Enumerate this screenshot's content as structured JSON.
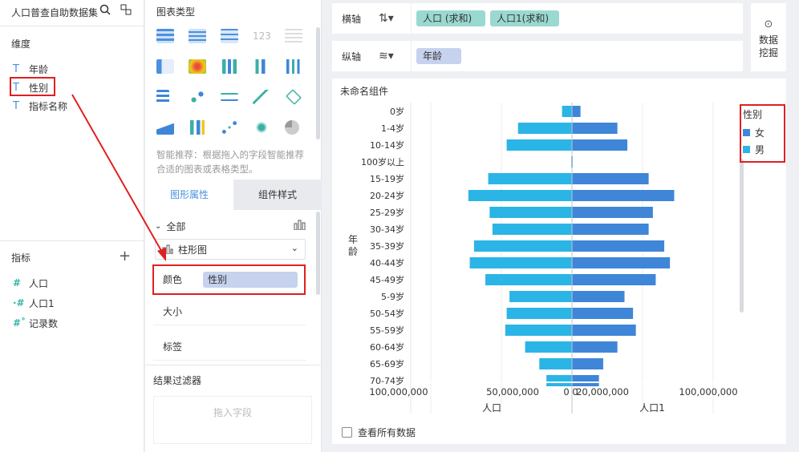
{
  "left_panel": {
    "dataset_title": "人口普查自助数据集",
    "dimensions_header": "维度",
    "dimensions": [
      {
        "label": "年龄",
        "type_glyph": "T"
      },
      {
        "label": "性别",
        "type_glyph": "T"
      },
      {
        "label": "指标名称",
        "type_glyph": "T"
      }
    ],
    "metrics_header": "指标",
    "metrics": [
      {
        "label": "人口",
        "type_glyph": "#"
      },
      {
        "label": "人口1",
        "type_glyph": "·#"
      },
      {
        "label": "记录数",
        "type_glyph": "#˚"
      }
    ]
  },
  "mid_panel": {
    "chart_types_header": "图表类型",
    "smart_tip": "智能推荐：根据拖入的字段智能推荐合适的图表或表格类型。",
    "tabs": [
      "图形属性",
      "组件样式"
    ],
    "all_label": "全部",
    "chart_type_select": "柱形图",
    "color_label": "颜色",
    "color_field": "性别",
    "size_label": "大小",
    "label_label": "标签",
    "filter_header": "结果过滤器",
    "filter_placeholder": "拖入字段"
  },
  "shelves": {
    "x_label": "横轴",
    "x_pills": [
      "人口 (求和)",
      "人口1(求和)"
    ],
    "y_label": "纵轴",
    "y_pills": [
      "年龄"
    ],
    "mining_label": "数据挖掘"
  },
  "chart_header": "未命名组件",
  "legend": {
    "title": "性别",
    "items": [
      {
        "label": "女",
        "color": "#3f86d8"
      },
      {
        "label": "男",
        "color": "#2bb4e6"
      }
    ]
  },
  "view_all_label": "查看所有数据",
  "colors": {
    "female": "#3f86d8",
    "male": "#2bb4e6",
    "accent": "#4a90e2",
    "highlight": "#e02020"
  },
  "chart_data": {
    "type": "bar",
    "orientation": "horizontal-diverging",
    "ylabel": "年龄",
    "categories": [
      "0岁",
      "1-4岁",
      "10-14岁",
      "100岁以上",
      "15-19岁",
      "20-24岁",
      "25-29岁",
      "30-34岁",
      "35-39岁",
      "40-44岁",
      "45-49岁",
      "5-9岁",
      "50-54岁",
      "55-59岁",
      "60-64岁",
      "65-69岁",
      "70-74岁"
    ],
    "series": [
      {
        "name": "男",
        "axis_label": "人口",
        "values": [
          7000000,
          38000000,
          46000000,
          500000,
          59000000,
          73000000,
          58000000,
          56000000,
          69000000,
          72000000,
          61000000,
          44000000,
          46000000,
          47000000,
          33000000,
          23000000,
          18000000
        ]
      },
      {
        "name": "女",
        "axis_label": "人口1",
        "values": [
          6000000,
          32000000,
          39000000,
          500000,
          54000000,
          72000000,
          57000000,
          54000000,
          65000000,
          69000000,
          59000000,
          37000000,
          43000000,
          45000000,
          32000000,
          22000000,
          19000000
        ]
      }
    ],
    "left_ticks": [
      "100,000,000",
      "50,000,000",
      "0"
    ],
    "right_ticks": [
      "0",
      "20,000,000",
      "100,000,000"
    ],
    "xlim": [
      0,
      113000000
    ]
  }
}
